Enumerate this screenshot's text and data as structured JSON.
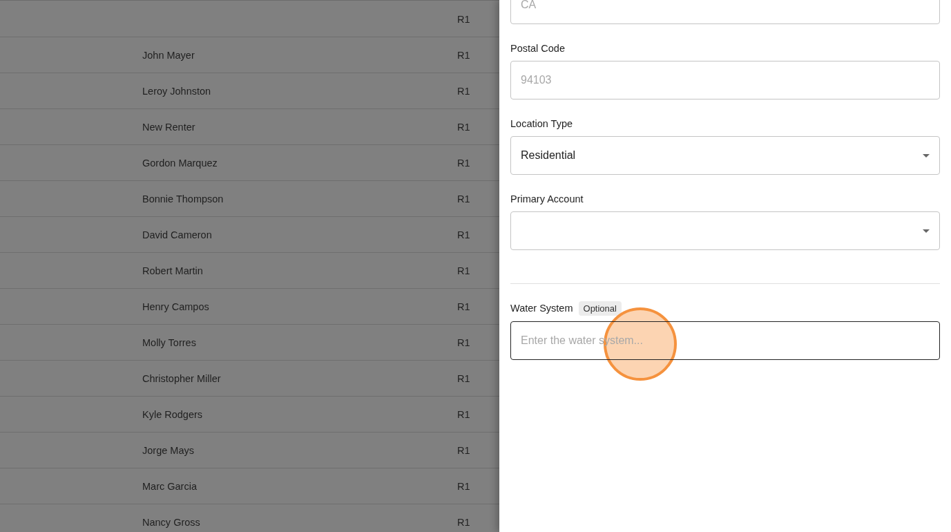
{
  "table": {
    "rows": [
      {
        "code": "R1"
      },
      {
        "name": "John Mayer",
        "code": "R1"
      },
      {
        "name": "Leroy Johnston",
        "code": "R1"
      },
      {
        "name": "New Renter",
        "code": "R1"
      },
      {
        "name": "Gordon Marquez",
        "code": "R1"
      },
      {
        "name": "Bonnie Thompson",
        "code": "R1"
      },
      {
        "name": "David Cameron",
        "code": "R1"
      },
      {
        "name": "Robert Martin",
        "code": "R1"
      },
      {
        "name": "Henry Campos",
        "code": "R1"
      },
      {
        "name": "Molly Torres",
        "code": "R1"
      },
      {
        "name": "Christopher Miller",
        "code": "R1"
      },
      {
        "name": "Kyle Rodgers",
        "code": "R1"
      },
      {
        "name": "Jorge Mays",
        "code": "R1"
      },
      {
        "name": "Marc Garcia",
        "code": "R1"
      },
      {
        "name": "Nancy Gross",
        "code": "R1"
      }
    ]
  },
  "form": {
    "fields": [
      {
        "kind": "text",
        "placeholder": "CA"
      },
      {
        "kind": "text",
        "label": "Postal Code",
        "placeholder": "94103"
      },
      {
        "kind": "select",
        "label": "Location Type",
        "value": "Residential"
      },
      {
        "kind": "select",
        "label": "Primary Account"
      }
    ],
    "water_system": {
      "label": "Water System",
      "badge": "Optional",
      "placeholder": "Enter the water system...",
      "focused": true
    }
  }
}
